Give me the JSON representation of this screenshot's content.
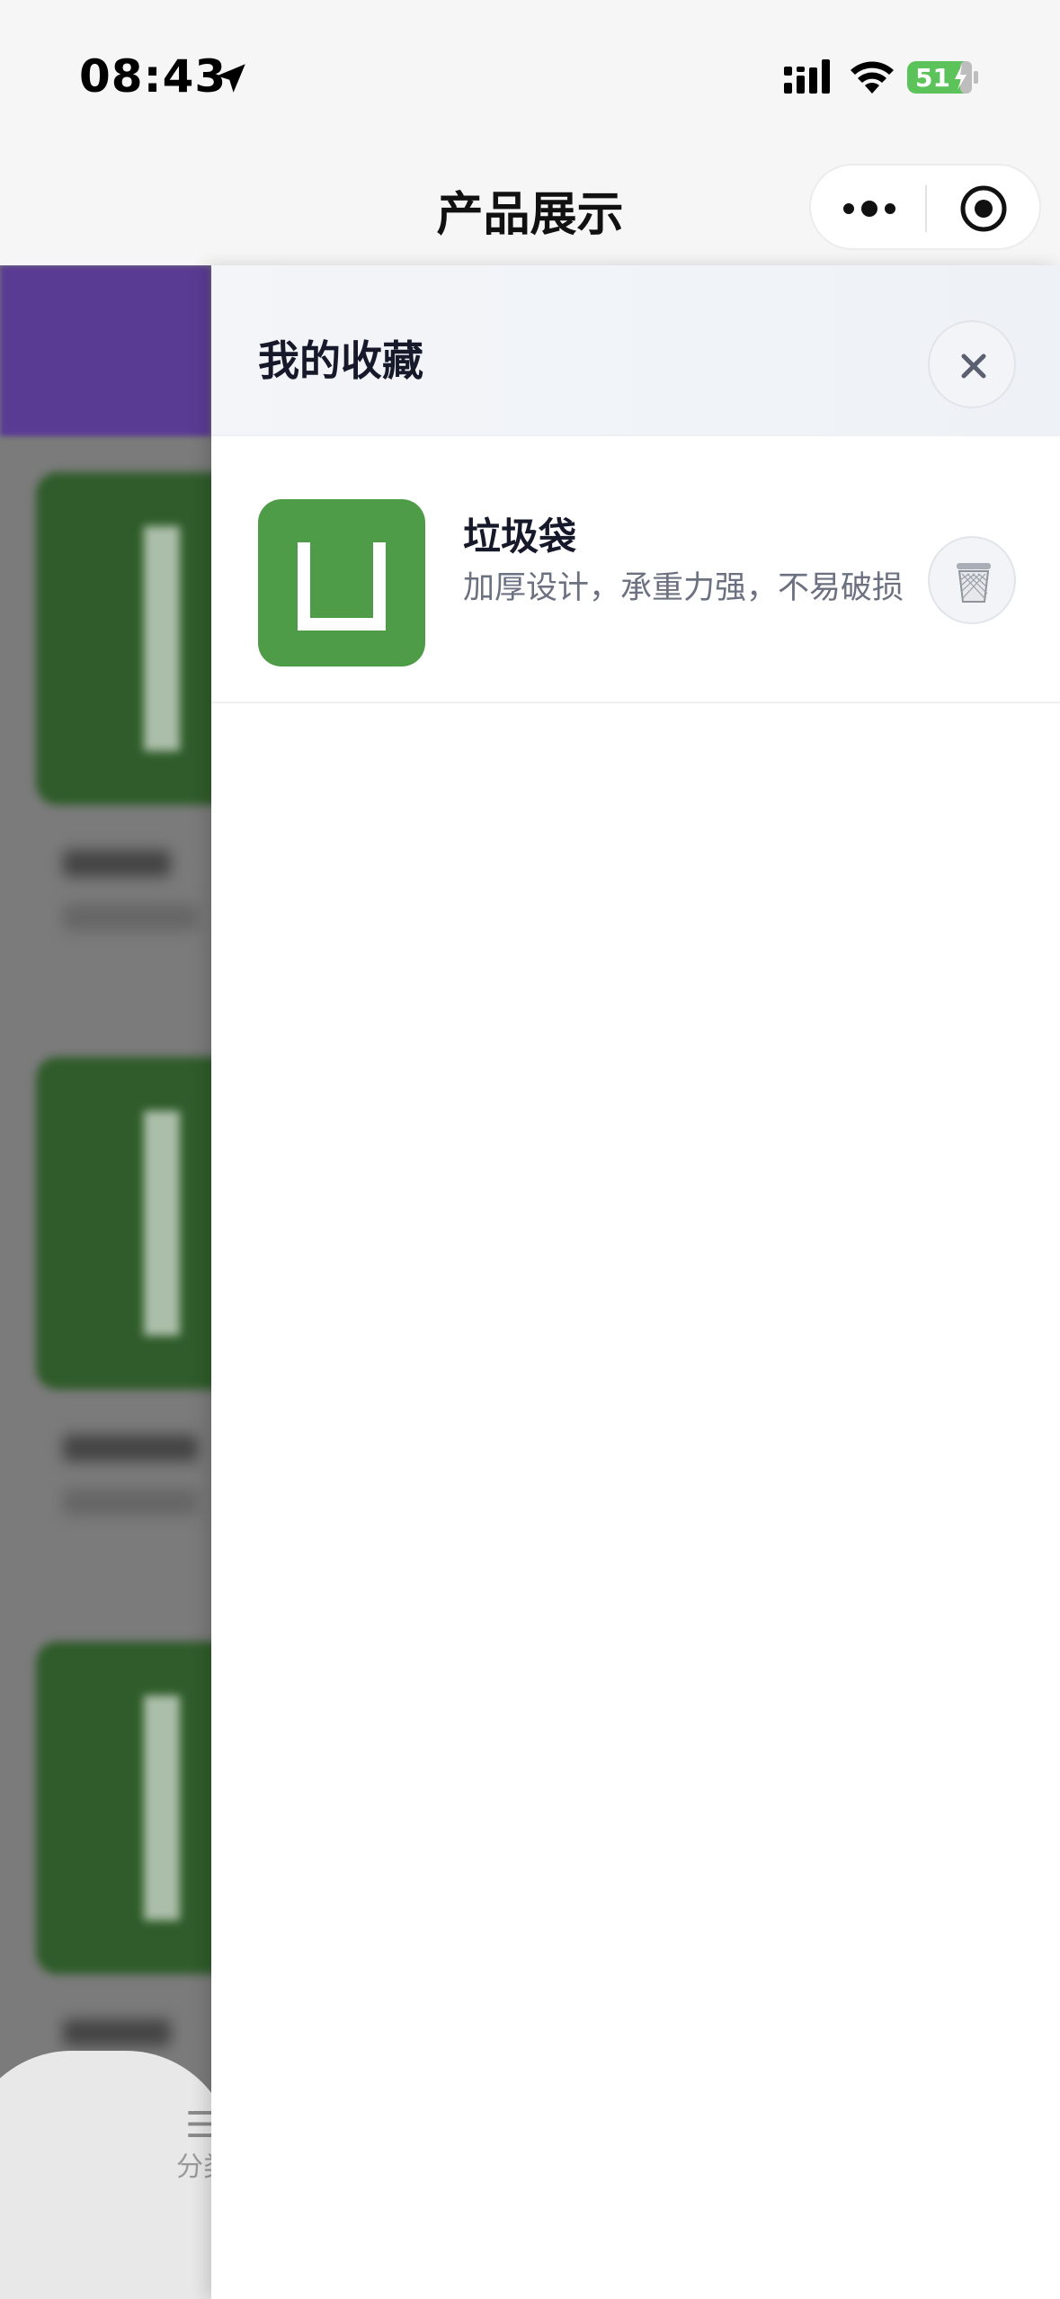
{
  "status_bar": {
    "time": "08:43",
    "battery_level": "51",
    "icons": [
      "location-arrow-icon",
      "cellular-signal-icon",
      "wifi-icon",
      "battery-charging-icon"
    ],
    "battery_color": "#5cc25a"
  },
  "nav": {
    "title": "产品展示",
    "capsule_icons": [
      "more-dots-icon",
      "target-circle-icon"
    ]
  },
  "background_page": {
    "tab_icon": "☰",
    "tab_label": "分类",
    "banner_color": "#5a3b93",
    "card_color": "#2f5c2a"
  },
  "favorites_drawer": {
    "title": "我的收藏",
    "close_icon": "close-icon",
    "items": [
      {
        "name": "垃圾袋",
        "description": "加厚设计，承重力强，不易破损",
        "thumb_color": "#4f9c48",
        "delete_icon": "trash-icon"
      }
    ]
  }
}
